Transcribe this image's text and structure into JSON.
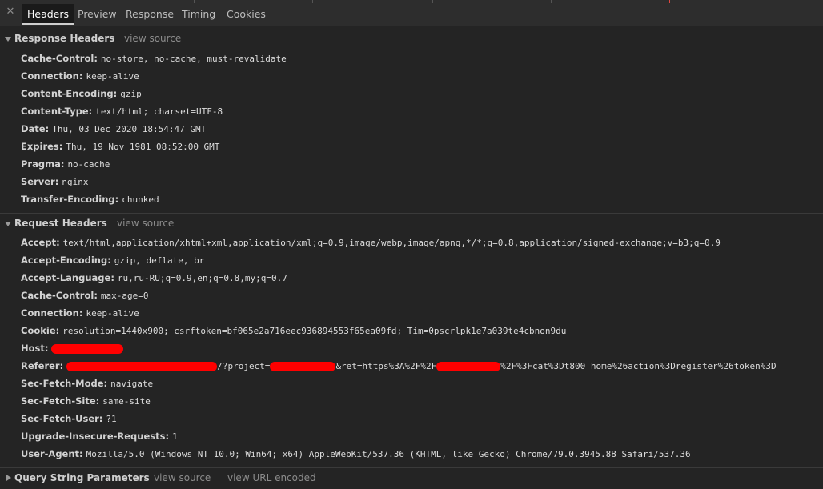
{
  "tabs": [
    "Headers",
    "Preview",
    "Response",
    "Timing",
    "Cookies"
  ],
  "sections": {
    "response": {
      "title": "Response Headers",
      "view_source": "view source",
      "headers": [
        {
          "name": "Cache-Control:",
          "value": "no-store, no-cache, must-revalidate"
        },
        {
          "name": "Connection:",
          "value": "keep-alive"
        },
        {
          "name": "Content-Encoding:",
          "value": "gzip"
        },
        {
          "name": "Content-Type:",
          "value": "text/html; charset=UTF-8"
        },
        {
          "name": "Date:",
          "value": "Thu, 03 Dec 2020 18:54:47 GMT"
        },
        {
          "name": "Expires:",
          "value": "Thu, 19 Nov 1981 08:52:00 GMT"
        },
        {
          "name": "Pragma:",
          "value": "no-cache"
        },
        {
          "name": "Server:",
          "value": "nginx"
        },
        {
          "name": "Transfer-Encoding:",
          "value": "chunked"
        }
      ]
    },
    "request": {
      "title": "Request Headers",
      "view_source": "view source",
      "headers": [
        {
          "name": "Accept:",
          "value": "text/html,application/xhtml+xml,application/xml;q=0.9,image/webp,image/apng,*/*;q=0.8,application/signed-exchange;v=b3;q=0.9"
        },
        {
          "name": "Accept-Encoding:",
          "value": "gzip, deflate, br"
        },
        {
          "name": "Accept-Language:",
          "value": "ru,ru-RU;q=0.9,en;q=0.8,my;q=0.7"
        },
        {
          "name": "Cache-Control:",
          "value": "max-age=0"
        },
        {
          "name": "Connection:",
          "value": "keep-alive"
        },
        {
          "name": "Cookie:",
          "value": "resolution=1440x900; csrftoken=bf065e2a716eec936894553f65ea09fd; Tim=0pscrlpk1e7a039te4cbnon9du"
        },
        {
          "name": "Host:",
          "value": ""
        },
        {
          "name": "Referer:",
          "value": ""
        },
        {
          "name": "Sec-Fetch-Mode:",
          "value": "navigate"
        },
        {
          "name": "Sec-Fetch-Site:",
          "value": "same-site"
        },
        {
          "name": "Sec-Fetch-User:",
          "value": "?1"
        },
        {
          "name": "Upgrade-Insecure-Requests:",
          "value": "1"
        },
        {
          "name": "User-Agent:",
          "value": "Mozilla/5.0 (Windows NT 10.0; Win64; x64) AppleWebKit/537.36 (KHTML, like Gecko) Chrome/79.0.3945.88 Safari/537.36"
        }
      ],
      "referer_parts": [
        "/?project=",
        "&ret=https%3A%2F%2F",
        "%2F%3Fcat%3Dt800_home%26action%3Dregister%26token%3D"
      ]
    },
    "query": {
      "title": "Query String Parameters",
      "view_source": "view source",
      "view_url_encoded": "view URL encoded"
    }
  }
}
